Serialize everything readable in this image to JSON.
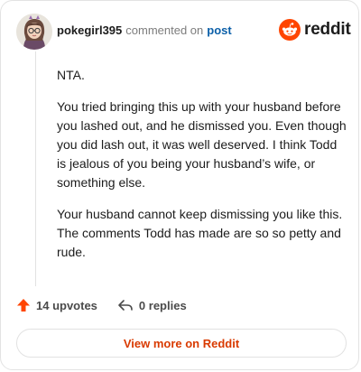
{
  "comment": {
    "username": "pokegirl395",
    "action_text": "commented on",
    "post_link": "post",
    "paragraphs": [
      "NTA.",
      "You tried bringing this up with your husband before you lashed out, and he dismissed you. Even though you did lash out, it was well deserved. I think Todd is jealous of you being your husband’s wife, or something else.",
      "Your husband cannot keep dismissing you like this. The comments Todd has made are so so petty and rude."
    ]
  },
  "brand": {
    "name": "reddit",
    "icon": "reddit-alien-icon",
    "color": "#ff4500"
  },
  "actions": {
    "upvotes": "14 upvotes",
    "upvote_icon": "upvote-arrow-icon",
    "upvote_color": "#ff4500",
    "replies": "0 replies",
    "reply_icon": "reply-arrow-icon"
  },
  "footer": {
    "view_more": "View more on Reddit",
    "accent": "#d93a00"
  }
}
